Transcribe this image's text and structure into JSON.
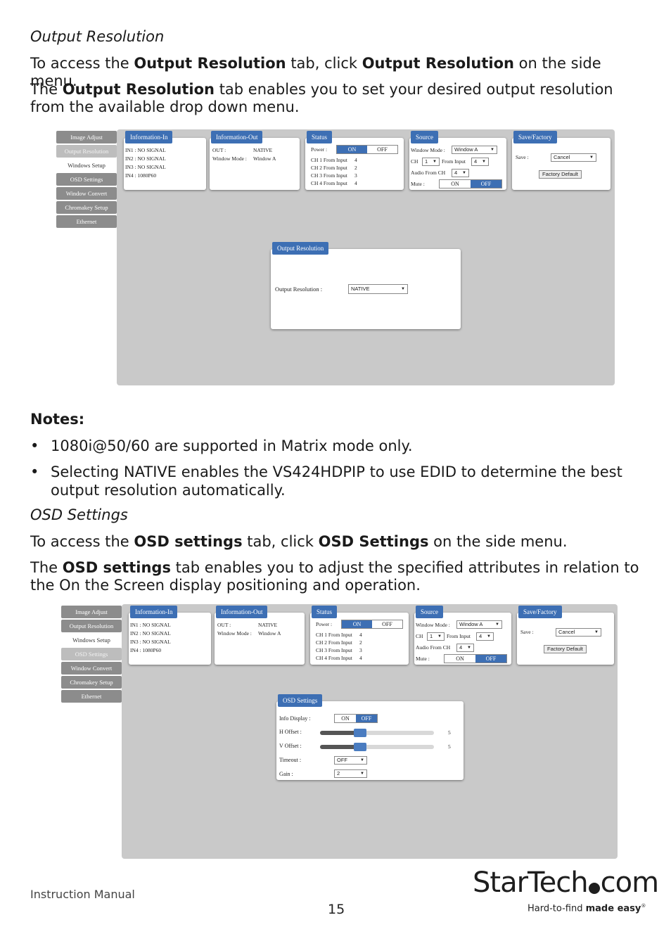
{
  "sec1": {
    "heading": "Output Resolution",
    "p1": [
      "To access the ",
      "Output Resolution",
      " tab, click ",
      "Output Resolution",
      " on the side menu."
    ],
    "p2": [
      "The ",
      "Output Resolution",
      " tab enables you to set your desired output resolution from the available drop down menu."
    ]
  },
  "shot_common": {
    "menu": [
      "Image Adjust",
      "Output Resolution",
      "Windows Setup",
      "OSD Settings",
      "Window Convert",
      "Chromakey Setup",
      "Ethernet"
    ],
    "info_in_title": "Information-In",
    "info_in_lines": [
      "IN1 : NO SIGNAL",
      "IN2 : NO SIGNAL",
      "IN3 : NO SIGNAL",
      "IN4 : 1080P60"
    ],
    "info_out_title": "Information-Out",
    "out_label": "OUT :",
    "out_value": "NATIVE",
    "wm_label": "Window Mode :",
    "wm_value": "Window A",
    "status_title": "Status",
    "power_label": "Power :",
    "on": "ON",
    "off": "OFF",
    "ch_lines": [
      "CH 1 From Input",
      "CH 2 From Input",
      "CH 3 From Input",
      "CH 4 From Input"
    ],
    "ch_vals": [
      "4",
      "2",
      "3",
      "4"
    ],
    "source_title": "Source",
    "src_wm_label": "Window Mode :",
    "src_wm_value": "Window A",
    "src_ch_label": "CH",
    "src_ch_value": "1",
    "src_from_label": "From Input",
    "src_from_value": "4",
    "src_audio_label": "Audio From CH",
    "src_audio_value": "4",
    "src_mute_label": "Mute :",
    "save_title": "Save/Factory",
    "save_label": "Save :",
    "save_value": "Cancel",
    "factory_btn": "Factory Default"
  },
  "shot1": {
    "panel_title": "Output Resolution",
    "field_label": "Output Resolution :",
    "field_value": "NATIVE"
  },
  "notes": {
    "title": "Notes:",
    "items": [
      "1080i@50/60 are supported in Matrix mode only.",
      "Selecting NATIVE enables the VS424HDPIP to use EDID to determine the best output resolution automatically."
    ]
  },
  "sec2": {
    "heading": "OSD Settings",
    "p1": [
      "To access the ",
      "OSD settings",
      " tab, click ",
      "OSD Settings",
      " on the side menu."
    ],
    "p2": [
      "The ",
      "OSD settings",
      " tab enables you to adjust the specified attributes in relation to the On the Screen display positioning and operation."
    ]
  },
  "shot2": {
    "panel_title": "OSD Settings",
    "info_label": "Info Display :",
    "h_label": "H Offset :",
    "h_value": "5",
    "h_level": 0.35,
    "v_label": "V Offset :",
    "v_value": "5",
    "v_level": 0.35,
    "timeout_label": "Timeout :",
    "timeout_value": "OFF",
    "gain_label": "Gain :",
    "gain_value": "2"
  },
  "footer": {
    "left": "Instruction Manual",
    "page": "15",
    "logo_a": "StarTech",
    "logo_b": "com",
    "tag_a": "Hard-to-find ",
    "tag_b": "made easy",
    "tag_reg": "®"
  }
}
